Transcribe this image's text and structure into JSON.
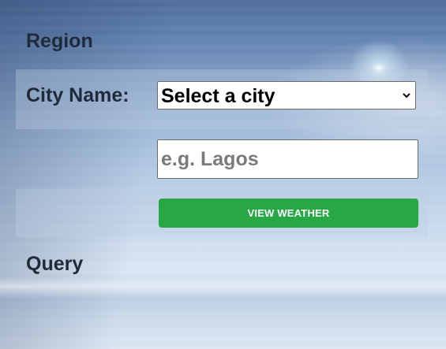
{
  "form": {
    "region_heading": "Region",
    "city_label": "City Name:",
    "city_select": {
      "selected": "Select a city",
      "options": [
        "Select a city"
      ]
    },
    "city_input": {
      "value": "",
      "placeholder": "e.g. Lagos"
    },
    "submit_label": "VIEW WEATHER",
    "query_heading": "Query"
  },
  "colors": {
    "button_bg": "#28a745",
    "heading_text": "#1f2a3a"
  },
  "icons": {
    "select_arrow": "chevron-down-icon"
  }
}
